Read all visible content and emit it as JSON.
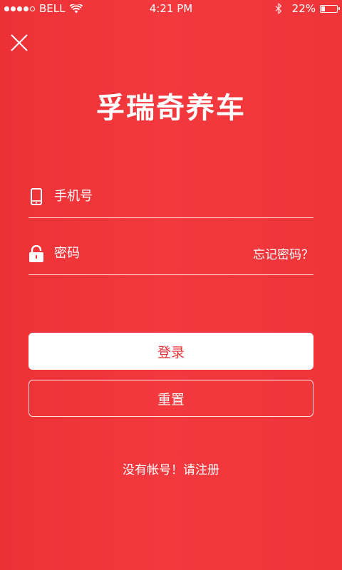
{
  "status_bar": {
    "carrier": "BELL",
    "time": "4:21 PM",
    "battery_percent_label": "22%",
    "battery_level": 0.22
  },
  "icons": {
    "close": "close-icon",
    "phone": "phone-icon",
    "lock": "lock-icon"
  },
  "app": {
    "title": "孚瑞奇养车"
  },
  "form": {
    "phone_placeholder": "手机号",
    "password_placeholder": "密码",
    "forgot_password": "忘记密码？"
  },
  "buttons": {
    "login": "登录",
    "reset": "重置"
  },
  "register": {
    "text": "没有帐号！请注册"
  },
  "colors": {
    "background": "#f0373c",
    "login_text": "#e8353a"
  }
}
